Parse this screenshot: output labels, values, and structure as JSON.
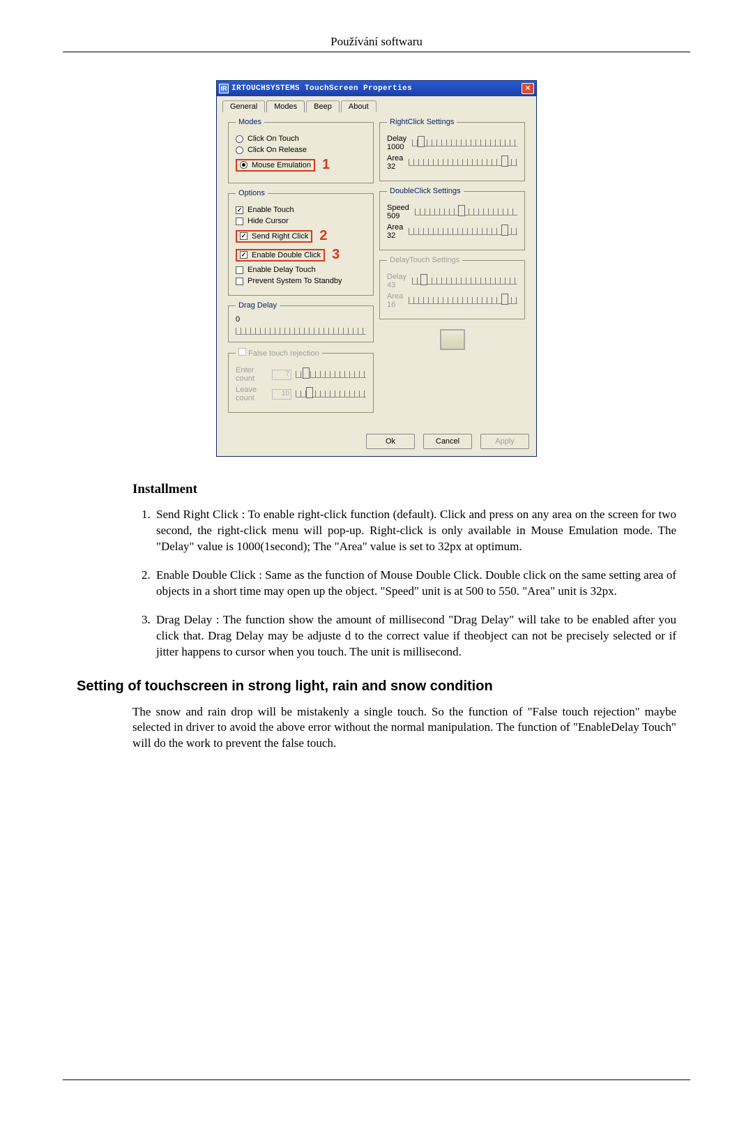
{
  "header_text": "Používání softwaru",
  "dialog": {
    "title": "IRTOUCHSYSTEMS TouchScreen Properties",
    "tabs": {
      "general": "General",
      "modes": "Modes",
      "beep": "Beep",
      "about": "About"
    },
    "modes_group": {
      "legend": "Modes",
      "click_on_touch": "Click On Touch",
      "click_on_release": "Click On Release",
      "mouse_emulation": "Mouse Emulation"
    },
    "options_group": {
      "legend": "Options",
      "enable_touch": "Enable Touch",
      "hide_cursor": "Hide Cursor",
      "send_right_click": "Send Right Click",
      "enable_double_click": "Enable Double Click",
      "enable_delay_touch": "Enable Delay Touch",
      "prevent_standby": "Prevent System To Standby"
    },
    "drag_delay": {
      "legend": "Drag Delay",
      "value": "0"
    },
    "false_touch": {
      "legend": "False touch rejection",
      "enter_label": "Enter count",
      "enter_value": "7",
      "leave_label": "Leave count",
      "leave_value": "10"
    },
    "rightclick": {
      "legend": "RightClick Settings",
      "delay_label": "Delay",
      "delay_value": "1000",
      "area_label": "Area",
      "area_value": "32"
    },
    "doubleclick": {
      "legend": "DoubleClick Settings",
      "speed_label": "Speed",
      "speed_value": "509",
      "area_label": "Area",
      "area_value": "32"
    },
    "delaytouch": {
      "legend": "DelayTouch Settings",
      "delay_label": "Delay",
      "delay_value": "43",
      "area_label": "Area",
      "area_value": "16"
    },
    "buttons": {
      "ok": "Ok",
      "cancel": "Cancel",
      "apply": "Apply"
    },
    "annotations": {
      "one": "1",
      "two": "2",
      "three": "3"
    }
  },
  "installment": {
    "heading": "Installment",
    "items": [
      "Send Right Click : To enable right-click function (default). Click and press on any area on the screen for two second, the right-click menu will pop-up. Right-click is only available in Mouse Emulation mode. The \"Delay\" value is 1000(1second); The \"Area\" value is set to 32px at optimum.",
      "Enable Double Click : Same as the function of Mouse Double Click. Double click on the same setting area of objects in a short time may open up the object. \"Speed\" unit is at 500 to 550. \"Area\" unit is 32px.",
      "Drag Delay : The function show the amount of millisecond \"Drag Delay\" will take to be enabled after you click that. Drag Delay may be adjuste d to the correct value if theobject can not be precisely selected or if jitter happens to cursor when you touch. The unit is millisecond."
    ]
  },
  "env_heading": "Setting of touchscreen in strong light, rain and snow condition",
  "env_para": "The snow and rain drop will be mistakenly a single touch. So the function of \"False touch rejection\" maybe selected in driver to avoid the above error without the normal manipulation. The function of \"EnableDelay Touch\" will do the work to prevent the false touch."
}
